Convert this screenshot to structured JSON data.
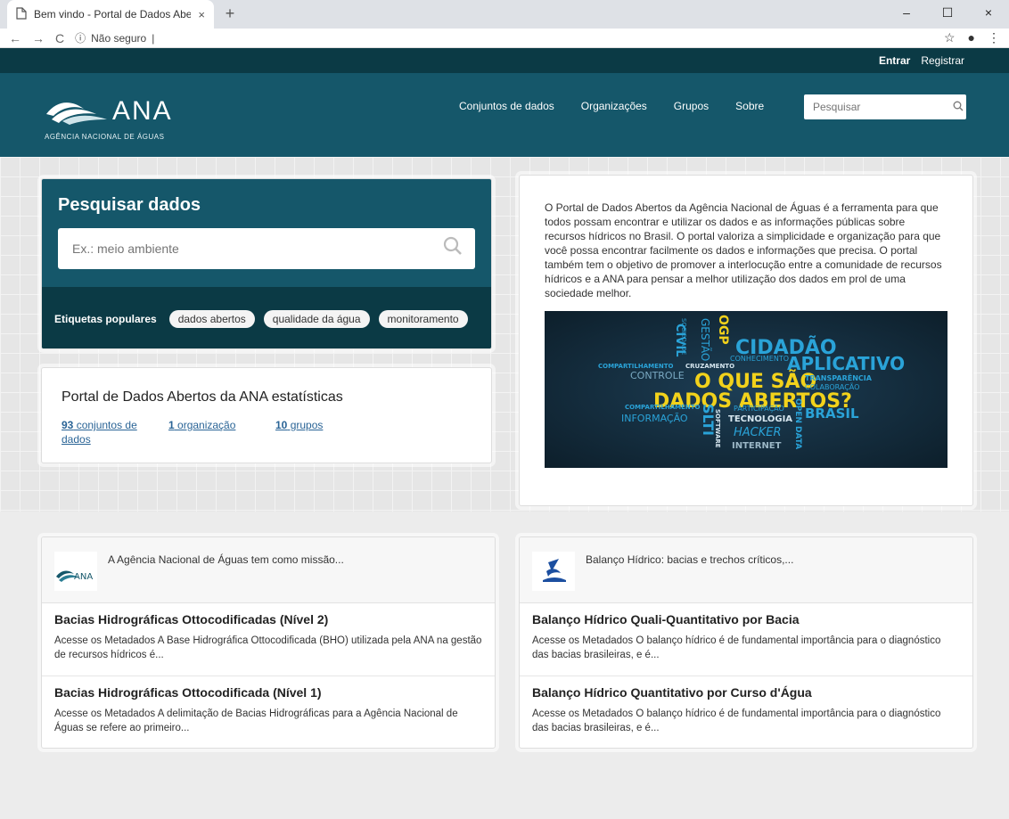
{
  "browser": {
    "tab_title": "Bem vindo - Portal de Dados Abe",
    "address": "Não seguro",
    "new_tab": "+",
    "tab_close": "×",
    "win_min": "–",
    "win_max": "☐",
    "win_close": "×"
  },
  "account": {
    "login": "Entrar",
    "register": "Registrar"
  },
  "header": {
    "logo_word": "ANA",
    "logo_sub": "AGÊNCIA NACIONAL DE ÁGUAS",
    "nav": [
      "Conjuntos de dados",
      "Organizações",
      "Grupos",
      "Sobre"
    ],
    "search_placeholder": "Pesquisar"
  },
  "search": {
    "title": "Pesquisar dados",
    "placeholder": "Ex.: meio ambiente",
    "tags_label": "Etiquetas populares",
    "tags": [
      "dados abertos",
      "qualidade da água",
      "monitoramento"
    ]
  },
  "stats": {
    "title": "Portal de Dados Abertos da ANA estatísticas",
    "datasets_count": "93",
    "datasets_label": " conjuntos de dados",
    "orgs_count": "1",
    "orgs_label": " organização",
    "groups_count": "10",
    "groups_label": " grupos"
  },
  "about": {
    "text": "O Portal de Dados Abertos da Agência Nacional de Águas é a ferramenta para que todos possam encontrar e utilizar os dados e as informações públicas sobre recursos hídricos no Brasil. O portal valoriza a simplicidade e organização para que você possa encontrar facilmente os dados e informações que precisa. O portal também tem o objetivo de promover a interlocução entre a comunidade de recursos hídricos e a ANA para pensar a melhor utilização dos dados em prol de uma sociedade melhor.",
    "cloud": {
      "cidadao": "CIDADÃO",
      "aplicativo": "APLICATIVO",
      "o_que_sao": "O QUE SÃO",
      "dados_abertos": "DADOS ABERTOS?",
      "brasil": "BRASIL",
      "controle": "CONTROLE",
      "tecnologia": "TECNOLOGIA",
      "informacao": "INFORMAÇÃO",
      "hacker": "HACKER",
      "internet": "INTERNET",
      "transparencia": "TRANSPARÊNCIA",
      "colaboracao": "COLABORAÇÃO",
      "compartilhamento": "COMPARTILHAMENTO",
      "participacao": "PARTICIPAÇÃO",
      "conhecimento": "CONHECIMENTO",
      "cruzamento": "CRUZAMENTO",
      "civil": "CIVIL",
      "gestao": "GESTÃO",
      "slti": "SLTI",
      "open_data": "OPEN DATA",
      "software": "SOFTWARE",
      "ogp": "OGP",
      "sociedade": "SOCIEDADE"
    }
  },
  "groups": [
    {
      "header": "A Agência Nacional de Águas tem como missão...",
      "logo_text": "ANA",
      "items": [
        {
          "title": "Bacias Hidrográficas Ottocodificadas (Nível 2)",
          "desc": "Acesse os Metadados A Base Hidrográfica Ottocodificada (BHO) utilizada pela ANA na gestão de recursos hídricos é..."
        },
        {
          "title": "Bacias Hidrográficas Ottocodificada (Nível 1)",
          "desc": "Acesse os Metadados A delimitação de Bacias Hidrográficas para a Agência Nacional de Águas se refere ao primeiro..."
        }
      ]
    },
    {
      "header": "Balanço Hídrico: bacias e trechos críticos,...",
      "items": [
        {
          "title": "Balanço Hídrico Quali-Quantitativo por Bacia",
          "desc": "Acesse os Metadados O balanço hídrico é de fundamental importância para o diagnóstico das bacias brasileiras, e é..."
        },
        {
          "title": "Balanço Hídrico Quantitativo por Curso d'Água",
          "desc": "Acesse os Metadados O balanço hídrico é de fundamental importância para o diagnóstico das bacias brasileiras, e é..."
        }
      ]
    }
  ],
  "colors": {
    "brand": "#15576a",
    "brand_dark": "#0b3a45",
    "link": "#2a6496",
    "cloud_yellow": "#f2d21b",
    "cloud_blue": "#2aa3d8"
  }
}
